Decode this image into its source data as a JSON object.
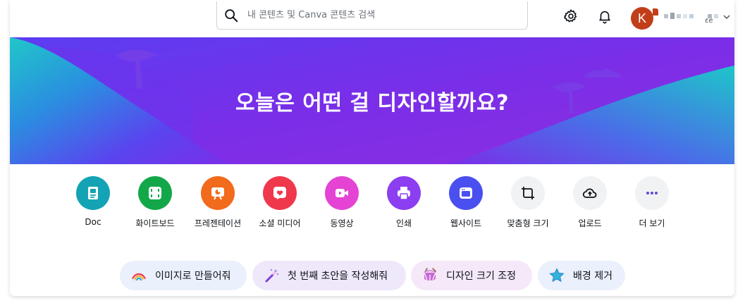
{
  "search": {
    "placeholder": "내 콘텐츠 및 Canva 콘텐츠 검색"
  },
  "header": {
    "avatar_initial": "K",
    "account_suffix": "ɛe",
    "icons": [
      "settings-icon",
      "bell-icon",
      "chevron-down-icon"
    ]
  },
  "hero": {
    "title": "오늘은 어떤 걸 디자인할까요?"
  },
  "design_types": [
    {
      "label": "Doc",
      "icon": "doc-icon",
      "color": "#13a3b5"
    },
    {
      "label": "화이트보드",
      "icon": "whiteboard-icon",
      "color": "#12a84a"
    },
    {
      "label": "프레젠테이션",
      "icon": "presentation-icon",
      "color": "#f26a1b"
    },
    {
      "label": "소셜 미디어",
      "icon": "heart-icon",
      "color": "#f0384d"
    },
    {
      "label": "동영상",
      "icon": "video-icon",
      "color": "#e443d4"
    },
    {
      "label": "인쇄",
      "icon": "printer-icon",
      "color": "#8b3ff0"
    },
    {
      "label": "웹사이트",
      "icon": "website-icon",
      "color": "#4a4ff0"
    },
    {
      "label": "맞춤형 크기",
      "icon": "resize-icon",
      "color": "#f1f2f4"
    },
    {
      "label": "업로드",
      "icon": "upload-cloud-icon",
      "color": "#f1f2f4"
    },
    {
      "label": "더 보기",
      "icon": "more-icon",
      "color": "#f1f2f4"
    }
  ],
  "suggestions": [
    {
      "label": "이미지로 만들어줘",
      "icon": "rainbow-icon"
    },
    {
      "label": "첫 번째 초안을 작성해줘",
      "icon": "magic-wand-icon"
    },
    {
      "label": "디자인 크기 조정",
      "icon": "drum-icon"
    },
    {
      "label": "배경 제거",
      "icon": "star-icon"
    }
  ]
}
